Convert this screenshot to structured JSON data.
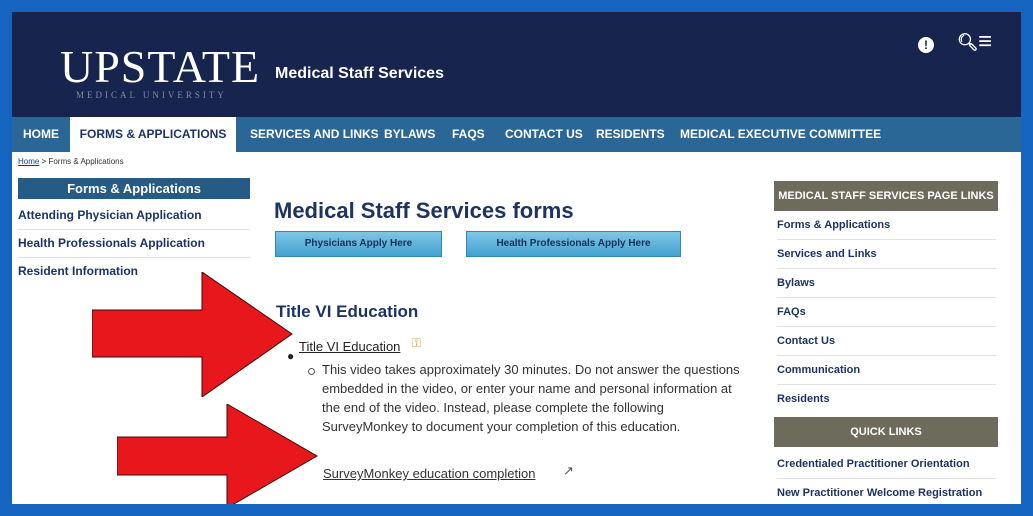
{
  "header": {
    "logo_main": "UPSTATE",
    "logo_sub": "MEDICAL UNIVERSITY",
    "site_title": "Medical Staff Services",
    "icons": [
      "info-icon",
      "search-icon",
      "menu-icon"
    ]
  },
  "nav": {
    "items": [
      {
        "label": "HOME"
      },
      {
        "label": "FORMS & APPLICATIONS",
        "active": true
      },
      {
        "label": "SERVICES AND LINKS"
      },
      {
        "label": "BYLAWS"
      },
      {
        "label": "FAQS"
      },
      {
        "label": "CONTACT US"
      },
      {
        "label": "RESIDENTS"
      },
      {
        "label": "MEDICAL EXECUTIVE COMMITTEE"
      }
    ]
  },
  "breadcrumb": {
    "home": "Home",
    "separator": " > ",
    "current": "Forms & Applications"
  },
  "left_sidebar": {
    "heading": "Forms & Applications",
    "items": [
      {
        "label": "Attending Physician Application"
      },
      {
        "label": "Health Professionals Application"
      },
      {
        "label": "Resident Information"
      }
    ]
  },
  "main": {
    "title": "Medical Staff Services forms",
    "buttons": [
      {
        "label": "Physicians Apply Here"
      },
      {
        "label": "Health Professionals Apply Here"
      }
    ],
    "section_title": "Title VI Education",
    "link_title_vi": "Title VI Education",
    "description": "This video takes approximately 30 minutes.  Do not answer the questions embedded in the video, or enter your name and personal information at the end of the video.  Instead, please complete the following SurveyMonkey to document your completion of this education.",
    "survey_link": "SurveyMonkey education completion"
  },
  "right_sidebar": {
    "heading": "MEDICAL STAFF SERVICES PAGE LINKS",
    "items": [
      {
        "label": "Forms & Applications"
      },
      {
        "label": "Services and Links"
      },
      {
        "label": "Bylaws"
      },
      {
        "label": "FAQs"
      },
      {
        "label": "Contact Us"
      },
      {
        "label": "Communication"
      },
      {
        "label": "Residents"
      }
    ],
    "quick_heading": "QUICK LINKS",
    "quick_items": [
      {
        "label": "Credentialed Practitioner Orientation"
      },
      {
        "label": "New Practitioner Welcome Registration"
      }
    ]
  },
  "colors": {
    "page_border": "#1565c0",
    "header_bg": "#16244e",
    "nav_bg": "#2b6796",
    "sidebar_head": "#245b87",
    "right_head": "#6e6b5c",
    "arrow": "#e8171c"
  }
}
